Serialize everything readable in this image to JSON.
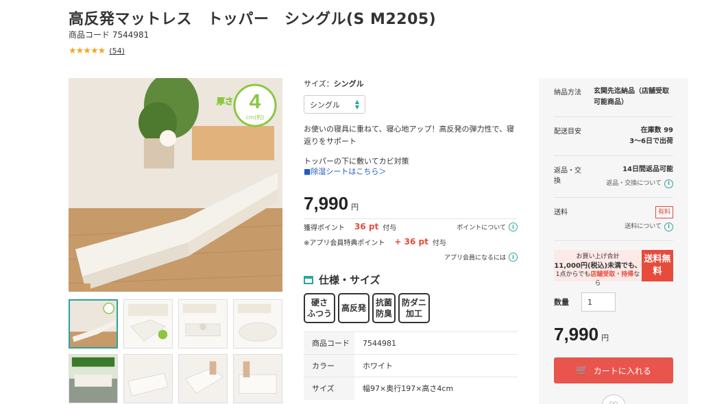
{
  "product": {
    "title": "高反発マットレス　トッパー　シングル(S M2205)",
    "code_label": "商品コード",
    "code": "7544981",
    "stars": "★★★★★",
    "review_count": "(54)",
    "image_caption": "厚さ",
    "image_thickness": "4",
    "image_unit": "cm(約)"
  },
  "options": {
    "size_label": "サイズ：",
    "size_value": "シングル",
    "selected": "シングル"
  },
  "description": {
    "line1": "お使いの寝具に重ねて、寝心地アップ！高反発の弾力性で、寝返りをサポート",
    "line2": "トッパーの下に敷いてカビ対策",
    "link": "■除湿シートはこちら＞"
  },
  "pricing": {
    "price": "7,990",
    "yen": "円",
    "points_label": "獲得ポイント",
    "points_value": "36 pt",
    "points_suffix": "付与",
    "points_link": "ポイントについて",
    "app_label": "※アプリ会員特典ポイント",
    "app_value": "+ 36 pt",
    "app_suffix": "付与",
    "app_link": "アプリ会員になるには"
  },
  "specs": {
    "heading": "仕様・サイズ",
    "badges": [
      {
        "l1": "硬さ",
        "l2": "ふつう"
      },
      {
        "l1": "高反発",
        "l2": ""
      },
      {
        "l1": "抗菌",
        "l2": "防臭"
      },
      {
        "l1": "防ダニ",
        "l2": "加工"
      }
    ],
    "rows": [
      {
        "k": "商品コード",
        "v": "7544981"
      },
      {
        "k": "カラー",
        "v": "ホワイト"
      },
      {
        "k": "サイズ",
        "v": "幅97×奥行197×高さ4cm"
      }
    ]
  },
  "purchase": {
    "delivery_method_label": "納品方法",
    "delivery_method_value": "玄関先迄納品（店舗受取可能商品）",
    "delivery_eta_label": "配送目安",
    "stock": "在庫数 99",
    "eta": "3〜6日で出荷",
    "returns_label": "返品・交換",
    "returns_value": "14日間返品可能",
    "returns_link": "返品・交換について",
    "shipping_label": "送料",
    "shipping_value": "有料",
    "shipping_link": "送料について",
    "promo_l1": "お買い上げ合計",
    "promo_l2": "11,000円(税込)未満でも、",
    "promo_l3a": "1点からでも",
    "promo_l3b": "店舗受取・持帰",
    "promo_l3c": "なら",
    "promo_badge": "送料無料",
    "qty_label": "数量",
    "qty_value": "1",
    "price": "7,990",
    "yen": "円",
    "cart_label": "カートに入れる"
  }
}
